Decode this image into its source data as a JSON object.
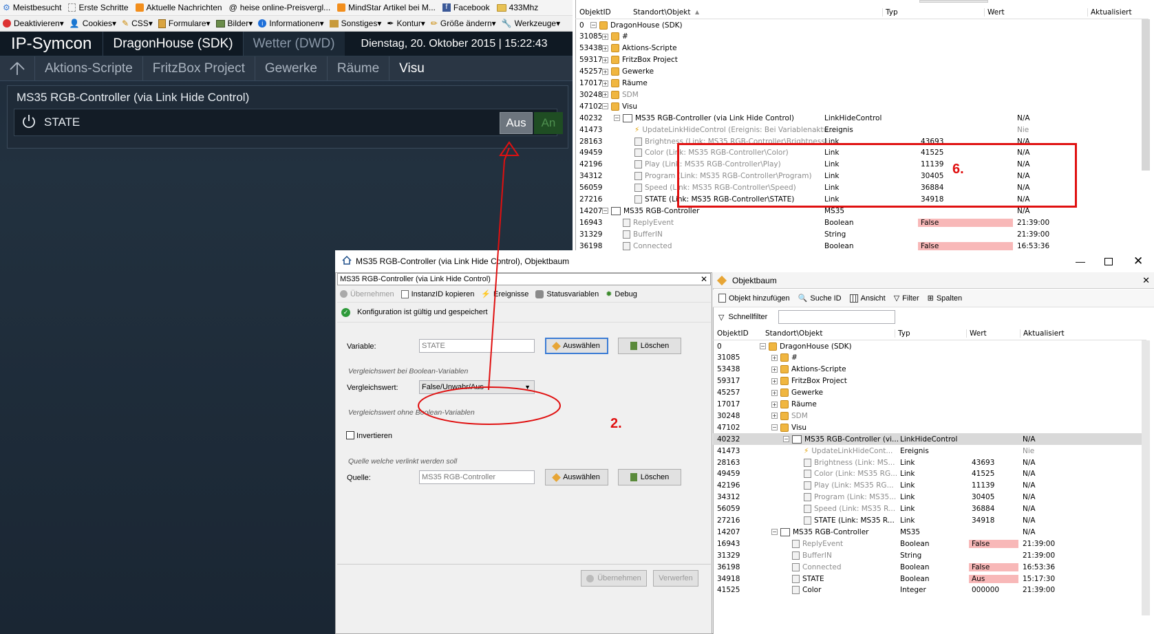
{
  "browser": {
    "bookmarks": [
      "Meistbesucht",
      "Erste Schritte",
      "Aktuelle Nachrichten",
      "heise online-Preisvergl...",
      "MindStar Artikel bei M...",
      "Facebook",
      "433Mhz"
    ],
    "webdev": [
      "Deaktivieren▾",
      "Cookies▾",
      "CSS▾",
      "Formulare▾",
      "Bilder▾",
      "Informationen▾",
      "Sonstiges▾",
      "Kontur▾",
      "Größe ändern▾",
      "Werkzeuge▾"
    ]
  },
  "symcon": {
    "logo": "IP-Symcon",
    "tab_active": "DragonHouse (SDK)",
    "tab_weather": "Wetter (DWD)",
    "datetime": "Dienstag, 20. Oktober 2015 | 15:22:43",
    "nav": [
      "Aktions-Scripte",
      "FritzBox Project",
      "Gewerke",
      "Räume",
      "Visu"
    ],
    "panel_title": "MS35 RGB-Controller (via Link Hide Control)",
    "state_label": "STATE",
    "btn_off": "Aus",
    "btn_on": "An"
  },
  "top_tree": {
    "headers": [
      "ObjektID",
      "Standort\\Objekt",
      "Typ",
      "Wert",
      "Aktualisiert"
    ],
    "rows": [
      {
        "id": "0",
        "name": "DragonHouse (SDK)",
        "typ": "",
        "wert": "",
        "upd": "",
        "depth": 0,
        "icon": "cube",
        "exp": "−"
      },
      {
        "id": "31085",
        "name": "#",
        "typ": "",
        "wert": "",
        "upd": "",
        "depth": 1,
        "icon": "cube",
        "exp": "+"
      },
      {
        "id": "53438",
        "name": "Aktions-Scripte",
        "typ": "",
        "wert": "",
        "upd": "",
        "depth": 1,
        "icon": "cube",
        "exp": "+"
      },
      {
        "id": "59317",
        "name": "FritzBox Project",
        "typ": "",
        "wert": "",
        "upd": "",
        "depth": 1,
        "icon": "cube",
        "exp": "+"
      },
      {
        "id": "45257",
        "name": "Gewerke",
        "typ": "",
        "wert": "",
        "upd": "",
        "depth": 1,
        "icon": "cube",
        "exp": "+"
      },
      {
        "id": "17017",
        "name": "Räume",
        "typ": "",
        "wert": "",
        "upd": "",
        "depth": 1,
        "icon": "cube",
        "exp": "+"
      },
      {
        "id": "30248",
        "name": "SDM",
        "typ": "",
        "wert": "",
        "upd": "",
        "depth": 1,
        "icon": "cube",
        "exp": "+",
        "grey": true
      },
      {
        "id": "47102",
        "name": "Visu",
        "typ": "",
        "wert": "",
        "upd": "",
        "depth": 1,
        "icon": "cube",
        "exp": "−"
      },
      {
        "id": "40232",
        "name": "MS35 RGB-Controller (via Link Hide Control)",
        "typ": "LinkHideControl",
        "wert": "",
        "upd": "N/A",
        "depth": 2,
        "icon": "folder",
        "exp": "−"
      },
      {
        "id": "41473",
        "name": "UpdateLinkHideControl  (Ereignis: Bei Variablenaktu...",
        "typ": "Ereignis",
        "wert": "",
        "upd": "Nie",
        "depth": 3,
        "icon": "bolt",
        "grey": true
      },
      {
        "id": "28163",
        "name": "Brightness (Link: MS35 RGB-Controller\\Brightness)",
        "typ": "Link",
        "wert": "43693",
        "upd": "N/A",
        "depth": 3,
        "icon": "doc",
        "grey": true
      },
      {
        "id": "49459",
        "name": "Color (Link: MS35 RGB-Controller\\Color)",
        "typ": "Link",
        "wert": "41525",
        "upd": "N/A",
        "depth": 3,
        "icon": "doc",
        "grey": true
      },
      {
        "id": "42196",
        "name": "Play (Link: MS35 RGB-Controller\\Play)",
        "typ": "Link",
        "wert": "11139",
        "upd": "N/A",
        "depth": 3,
        "icon": "doc",
        "grey": true
      },
      {
        "id": "34312",
        "name": "Program (Link: MS35 RGB-Controller\\Program)",
        "typ": "Link",
        "wert": "30405",
        "upd": "N/A",
        "depth": 3,
        "icon": "doc",
        "grey": true
      },
      {
        "id": "56059",
        "name": "Speed (Link: MS35 RGB-Controller\\Speed)",
        "typ": "Link",
        "wert": "36884",
        "upd": "N/A",
        "depth": 3,
        "icon": "doc",
        "grey": true
      },
      {
        "id": "27216",
        "name": "STATE (Link: MS35 RGB-Controller\\STATE)",
        "typ": "Link",
        "wert": "34918",
        "upd": "N/A",
        "depth": 3,
        "icon": "doc"
      },
      {
        "id": "14207",
        "name": "MS35 RGB-Controller",
        "typ": "MS35",
        "wert": "",
        "upd": "N/A",
        "depth": 1,
        "icon": "folder",
        "exp": "−"
      },
      {
        "id": "16943",
        "name": "ReplyEvent",
        "typ": "Boolean",
        "wert": "False",
        "upd": "21:39:00",
        "depth": 2,
        "icon": "doc",
        "grey": true,
        "red": true
      },
      {
        "id": "31329",
        "name": "BufferIN",
        "typ": "String",
        "wert": "",
        "upd": "21:39:00",
        "depth": 2,
        "icon": "doc",
        "grey": true
      },
      {
        "id": "36198",
        "name": "Connected",
        "typ": "Boolean",
        "wert": "False",
        "upd": "16:53:36",
        "depth": 2,
        "icon": "doc",
        "grey": true,
        "red": true
      }
    ]
  },
  "dialog": {
    "title": "MS35 RGB-Controller (via Link Hide Control), Objektbaum",
    "sub_title": "MS35 RGB-Controller (via Link Hide Control)",
    "toolbar": [
      "Übernehmen",
      "InstanzID kopieren",
      "Ereignisse",
      "Statusvariablen",
      "Debug"
    ],
    "status": "Konfiguration ist gültig und gespeichert",
    "variable_label": "Variable:",
    "variable_value": "STATE",
    "select_btn": "Auswählen",
    "delete_btn": "Löschen",
    "bool_hint": "Vergleichswert bei Boolean-Variablen",
    "compare_label": "Vergleichswert:",
    "compare_value": "False/Unwahr/Aus",
    "nonbool_hint": "Vergleichswert ohne Boolean-Variablen",
    "invert_label": "Invertieren",
    "source_hint": "Quelle welche  verlinkt werden soll",
    "source_label": "Quelle:",
    "source_value": "MS35 RGB-Controller",
    "apply_btn": "Übernehmen",
    "discard_btn": "Verwerfen"
  },
  "objektbaum": {
    "title": "Objektbaum",
    "toolbar": [
      "Objekt hinzufügen",
      "Suche ID",
      "Ansicht",
      "Filter",
      "Spalten"
    ],
    "filter_label": "Schnellfilter",
    "headers": [
      "ObjektID",
      "Standort\\Objekt",
      "Typ",
      "Wert",
      "Aktualisiert"
    ],
    "rows": [
      {
        "id": "0",
        "name": "DragonHouse (SDK)",
        "typ": "",
        "wert": "",
        "upd": "",
        "depth": 0,
        "icon": "cube",
        "exp": "−"
      },
      {
        "id": "31085",
        "name": "#",
        "typ": "",
        "wert": "",
        "upd": "",
        "depth": 1,
        "icon": "cube",
        "exp": "+"
      },
      {
        "id": "53438",
        "name": "Aktions-Scripte",
        "typ": "",
        "wert": "",
        "upd": "",
        "depth": 1,
        "icon": "cube",
        "exp": "+"
      },
      {
        "id": "59317",
        "name": "FritzBox Project",
        "typ": "",
        "wert": "",
        "upd": "",
        "depth": 1,
        "icon": "cube",
        "exp": "+"
      },
      {
        "id": "45257",
        "name": "Gewerke",
        "typ": "",
        "wert": "",
        "upd": "",
        "depth": 1,
        "icon": "cube",
        "exp": "+"
      },
      {
        "id": "17017",
        "name": "Räume",
        "typ": "",
        "wert": "",
        "upd": "",
        "depth": 1,
        "icon": "cube",
        "exp": "+"
      },
      {
        "id": "30248",
        "name": "SDM",
        "typ": "",
        "wert": "",
        "upd": "",
        "depth": 1,
        "icon": "cube",
        "exp": "+",
        "grey": true
      },
      {
        "id": "47102",
        "name": "Visu",
        "typ": "",
        "wert": "",
        "upd": "",
        "depth": 1,
        "icon": "cube",
        "exp": "−"
      },
      {
        "id": "40232",
        "name": "MS35 RGB-Controller (vi...",
        "typ": "LinkHideControl",
        "wert": "",
        "upd": "N/A",
        "depth": 2,
        "icon": "folder",
        "exp": "−",
        "sel": true
      },
      {
        "id": "41473",
        "name": "UpdateLinkHideCont...",
        "typ": "Ereignis",
        "wert": "",
        "upd": "Nie",
        "depth": 3,
        "icon": "bolt",
        "grey": true
      },
      {
        "id": "28163",
        "name": "Brightness (Link: MS...",
        "typ": "Link",
        "wert": "43693",
        "upd": "N/A",
        "depth": 3,
        "icon": "doc",
        "grey": true
      },
      {
        "id": "49459",
        "name": "Color (Link: MS35 RG...",
        "typ": "Link",
        "wert": "41525",
        "upd": "N/A",
        "depth": 3,
        "icon": "doc",
        "grey": true
      },
      {
        "id": "42196",
        "name": "Play (Link: MS35 RG...",
        "typ": "Link",
        "wert": "11139",
        "upd": "N/A",
        "depth": 3,
        "icon": "doc",
        "grey": true
      },
      {
        "id": "34312",
        "name": "Program (Link: MS35...",
        "typ": "Link",
        "wert": "30405",
        "upd": "N/A",
        "depth": 3,
        "icon": "doc",
        "grey": true
      },
      {
        "id": "56059",
        "name": "Speed (Link: MS35 R...",
        "typ": "Link",
        "wert": "36884",
        "upd": "N/A",
        "depth": 3,
        "icon": "doc",
        "grey": true
      },
      {
        "id": "27216",
        "name": "STATE (Link: MS35 R...",
        "typ": "Link",
        "wert": "34918",
        "upd": "N/A",
        "depth": 3,
        "icon": "doc"
      },
      {
        "id": "14207",
        "name": "MS35 RGB-Controller",
        "typ": "MS35",
        "wert": "",
        "upd": "N/A",
        "depth": 1,
        "icon": "folder",
        "exp": "−"
      },
      {
        "id": "16943",
        "name": "ReplyEvent",
        "typ": "Boolean",
        "wert": "False",
        "upd": "21:39:00",
        "depth": 2,
        "icon": "doc",
        "grey": true,
        "red": true
      },
      {
        "id": "31329",
        "name": "BufferIN",
        "typ": "String",
        "wert": "",
        "upd": "21:39:00",
        "depth": 2,
        "icon": "doc",
        "grey": true
      },
      {
        "id": "36198",
        "name": "Connected",
        "typ": "Boolean",
        "wert": "False",
        "upd": "16:53:36",
        "depth": 2,
        "icon": "doc",
        "grey": true,
        "red": true
      },
      {
        "id": "34918",
        "name": "STATE",
        "typ": "Boolean",
        "wert": "Aus",
        "upd": "15:17:30",
        "depth": 2,
        "icon": "doc",
        "red": true
      },
      {
        "id": "41525",
        "name": "Color",
        "typ": "Integer",
        "wert": "000000",
        "upd": "21:39:00",
        "depth": 2,
        "icon": "doc"
      }
    ]
  },
  "annotations": {
    "label6": "6.",
    "label2": "2."
  },
  "colors": {
    "annotation_red": "#e01010",
    "cell_red": "#f8b8b8",
    "web_bg": "#1e2b3a"
  }
}
